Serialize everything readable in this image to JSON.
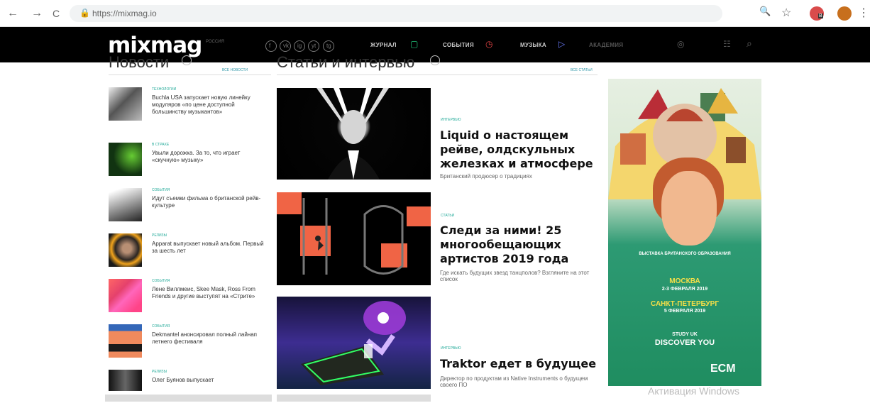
{
  "browser": {
    "url": "https://mixmag.io",
    "back": "←",
    "forward": "→",
    "reload": "C",
    "lock": "🔒",
    "zoom": "🔍",
    "bookmark": "☆",
    "menu": "⋮",
    "badge": "B"
  },
  "site": {
    "logo": "mixmag",
    "logo_tag": "РОССИЯ",
    "socials": [
      "f",
      "vk",
      "ig",
      "yt",
      "tg"
    ],
    "menu": [
      "ЖУРНАЛ",
      "СОБЫТИЯ",
      "МУЗЫКА",
      "АКАДЕМИЯ"
    ],
    "search": "⌕"
  },
  "sections": {
    "news": "Новости",
    "news_link": "ВСЕ НОВОСТИ",
    "articles": "Статьи и интервью",
    "articles_link": "ВСЕ СТАТЬИ"
  },
  "news": [
    {
      "cat": "ТЕХНОЛОГИИ",
      "text": "Buchla USA запускает новую линейку модуляров «по цене доступной большинству музыкантов»"
    },
    {
      "cat": "В СТРАХЕ",
      "text": "Увыли дорожка. За то, что играет «скучную» музыку»"
    },
    {
      "cat": "СОБЫТИЯ",
      "text": "Идут съемки фильма о британской рейв-культуре"
    },
    {
      "cat": "РЕЛИЗЫ",
      "text": "Apparat выпускает новый альбом. Первый за шесть лет"
    },
    {
      "cat": "СОБЫТИЯ",
      "text": "Лене Виллмеис, Skee Mask, Ross From Friends и другие выступят на «Стрите»"
    },
    {
      "cat": "СОБЫТИЯ",
      "text": "Dekmantel анонсировал полный лайнап летнего фестиваля"
    },
    {
      "cat": "РЕЛИЗЫ",
      "text": "Олег Буянов выпускает"
    }
  ],
  "articles": [
    {
      "cat": "ИНТЕРВЬЮ",
      "title": "Liquid о настоящем рейве, олдскульных железках и атмосфере",
      "desc": "Британский продюсер о традициях"
    },
    {
      "cat": "СТАТЬИ",
      "title": "Следи за ними! 25 многообещающих артистов 2019 года",
      "desc": "Где искать будущих звезд танцполов? Взгляните на этот список"
    },
    {
      "cat": "ИНТЕРВЬЮ",
      "title": "Traktor едет в будущее",
      "desc": "Директор по продуктам из Native Instruments о будущем своего ПО"
    }
  ],
  "ad": {
    "heading": "ВЫСТАВКА БРИТАНСКОГО ОБРАЗОВАНИЯ",
    "city1": "МОСКВА",
    "date1": "2-3 ФЕВРАЛЯ 2019",
    "city2": "САНКТ-ПЕТЕРБУРГ",
    "date2": "5 ФЕВРАЛЯ 2019",
    "small": "STUDY UK",
    "discover": "DISCOVER YOU",
    "logo": "ECM"
  },
  "windows": "Активация Windows"
}
